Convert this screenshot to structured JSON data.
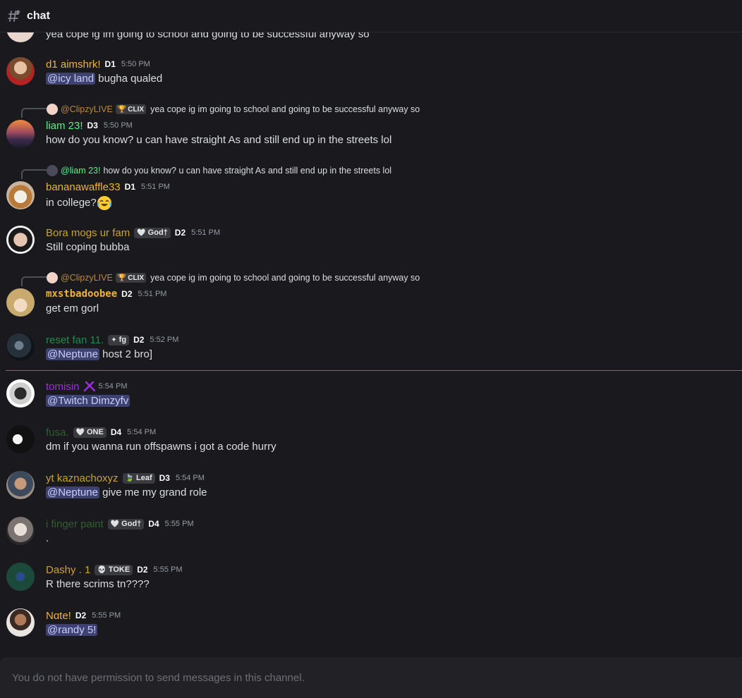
{
  "channel": {
    "icon": "hashtag-icon",
    "name": "chat"
  },
  "messages": [
    {
      "text": "yea cope ig im going to school and going to be successful anyway so"
    },
    {
      "author": "d1 aimshrk!",
      "author_color": "#f0b232",
      "division": "D1",
      "time": "5:50 PM",
      "mention": "@icy land",
      "text": " bugha qualed"
    },
    {
      "reply": {
        "author": "@ClipzyLIVE",
        "tag": "CLIX",
        "text": "yea cope ig im going to school and going to be successful anyway so"
      },
      "author": "liam 23!",
      "author_color": "#57f287",
      "division": "D3",
      "time": "5:50 PM",
      "text": "how do you know? u can have straight As and still end up in the streets lol"
    },
    {
      "reply": {
        "author": "@liam 23!",
        "text": "how do you know? u can have straight As and still end up in the streets lol"
      },
      "author": "bananawaffle33",
      "author_color": "#f0b232",
      "division": "D1",
      "time": "5:51 PM",
      "text": "in college?"
    },
    {
      "author": "Bora mogs ur fam",
      "author_color": "#c9a227",
      "tag": "God†",
      "division": "D2",
      "time": "5:51 PM",
      "text": "Still coping bubba"
    },
    {
      "reply": {
        "author": "@ClipzyLIVE",
        "tag": "CLIX",
        "text": "yea cope ig im going to school and going to be successful anyway so"
      },
      "author": "mxstbadoobee",
      "author_color": "#f0b232",
      "division": "D2",
      "time": "5:51 PM",
      "text": "get em gorl"
    },
    {
      "author": "reset fan 11.",
      "author_color": "#1f8b4c",
      "tag": "fg",
      "division": "D2",
      "time": "5:52 PM",
      "mention": "@Neptune",
      "text": " host 2 bro]"
    },
    {
      "author": "tomisin",
      "author_color": "#9b30d9",
      "time": "5:54 PM",
      "mention": "@Twitch Dimzyfv",
      "text": ""
    },
    {
      "author": "fusa.",
      "author_color": "#2f5f2f",
      "tag": "ONE",
      "division": "D4",
      "time": "5:54 PM",
      "text": "dm if you wanna run offspawns i got a code hurry"
    },
    {
      "author": "yt kaznachoxyz",
      "author_color": "#c9a227",
      "tag": "Leaf",
      "division": "D3",
      "time": "5:54 PM",
      "mention": "@Neptune",
      "text": " give me my grand role"
    },
    {
      "author": "i finger paint",
      "author_color": "#2f5f2f",
      "tag": "God†",
      "division": "D4",
      "time": "5:55 PM",
      "text": "."
    },
    {
      "author": "Dashy . 1",
      "author_color": "#c9a227",
      "tag": "TOKE",
      "division": "D2",
      "time": "5:55 PM",
      "text": "R there scrims tn????"
    },
    {
      "author": "Nɑte!",
      "author_color": "#f0b232",
      "division": "D2",
      "time": "5:55 PM",
      "mention": "@randy 5!",
      "text": ""
    }
  ],
  "composer": {
    "placeholder": "You do not have permission to send messages in this channel."
  }
}
